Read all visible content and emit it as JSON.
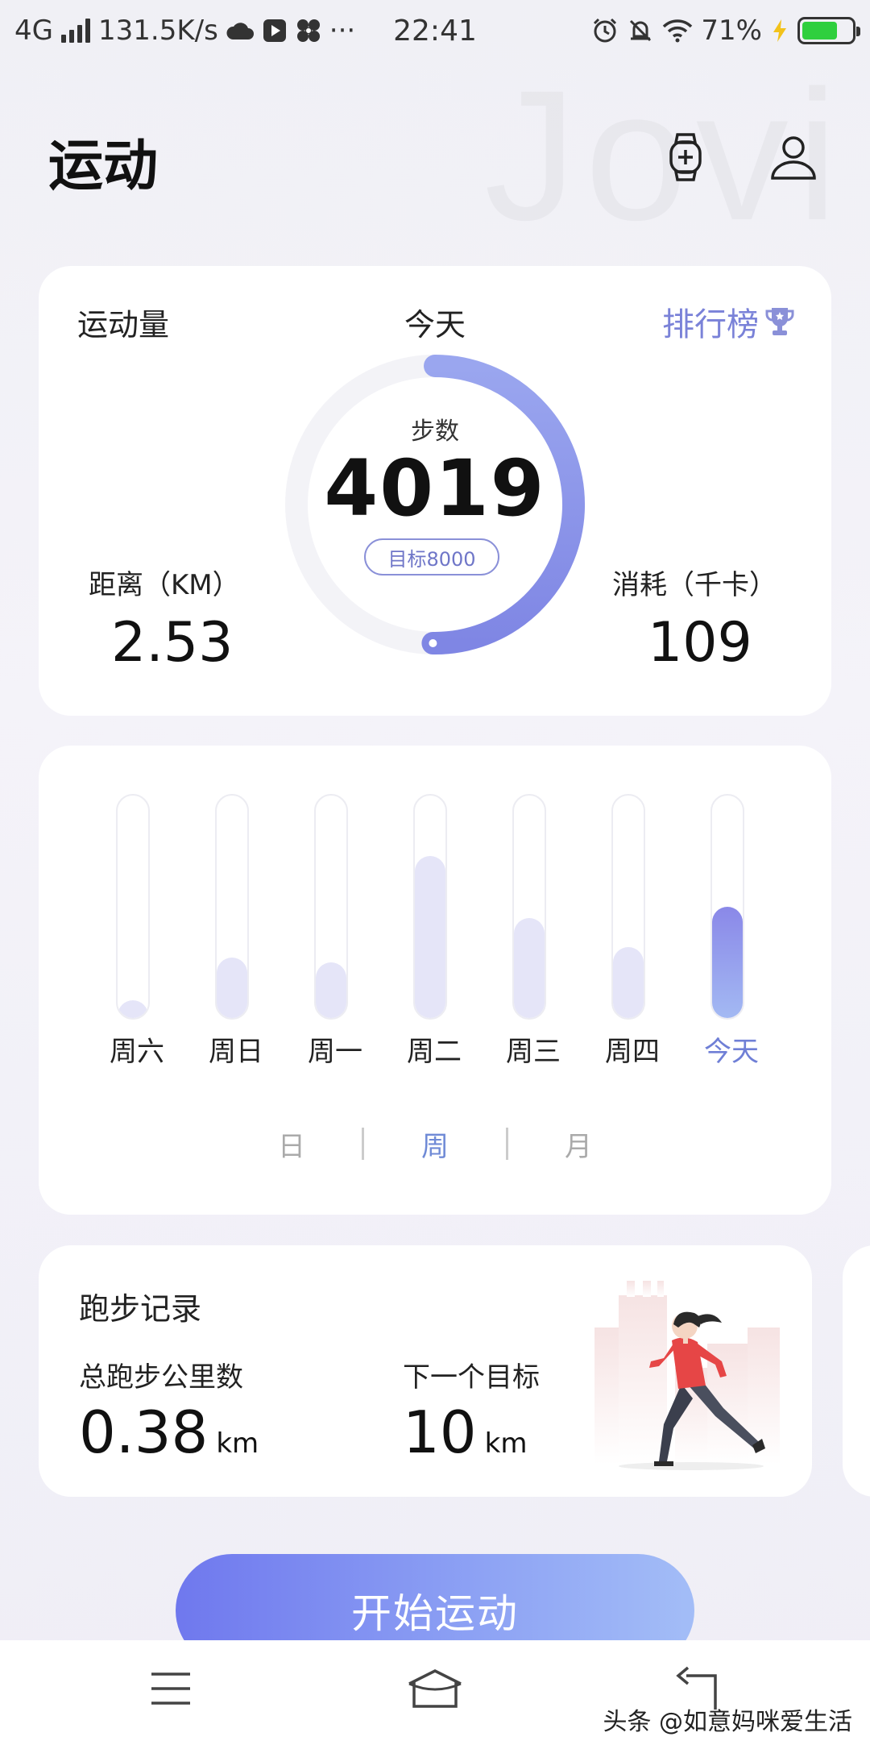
{
  "status_bar": {
    "network": "4G",
    "speed": "131.5K/s",
    "time": "22:41",
    "battery_pct": "71%",
    "battery_level": 0.71,
    "icons": [
      "signal-icon",
      "cloud-icon",
      "video-icon",
      "fan-icon",
      "more-icon",
      "alarm-icon",
      "mute-icon",
      "wifi-icon",
      "charging-icon",
      "battery-icon"
    ],
    "more": "···"
  },
  "header": {
    "title": "运动",
    "watermark": "Jovi",
    "icons": [
      "watch-add-icon",
      "profile-icon"
    ]
  },
  "summary": {
    "label": "运动量",
    "period": "今天",
    "ranking_label": "排行榜",
    "steps_label": "步数",
    "steps": "4019",
    "goal": "目标8000",
    "progress": 0.5024,
    "distance_label": "距离（KM）",
    "distance": "2.53",
    "calories_label": "消耗（千卡）",
    "calories": "109"
  },
  "week": {
    "days": [
      {
        "label": "周六",
        "level": 0.08
      },
      {
        "label": "周日",
        "level": 0.27
      },
      {
        "label": "周一",
        "level": 0.25
      },
      {
        "label": "周二",
        "level": 0.73
      },
      {
        "label": "周三",
        "level": 0.45
      },
      {
        "label": "周四",
        "level": 0.32
      },
      {
        "label": "今天",
        "level": 0.5
      }
    ],
    "tabs": [
      "日",
      "周",
      "月"
    ],
    "active_tab": "周"
  },
  "run": {
    "title": "跑步记录",
    "total_label": "总跑步公里数",
    "total_value": "0.38",
    "total_unit": "km",
    "next_label": "下一个目标",
    "next_value": "10",
    "next_unit": "km"
  },
  "start_button": "开始运动",
  "nav": {
    "icons": [
      "menu-icon",
      "home-icon",
      "back-icon"
    ]
  },
  "credit": "头条 @如意妈咪爱生活",
  "colors": {
    "accent": "#7a82d8",
    "progress": "#8a8ae6",
    "bar_today": "#8a88e8",
    "bar_other": "#e5e5f8"
  }
}
